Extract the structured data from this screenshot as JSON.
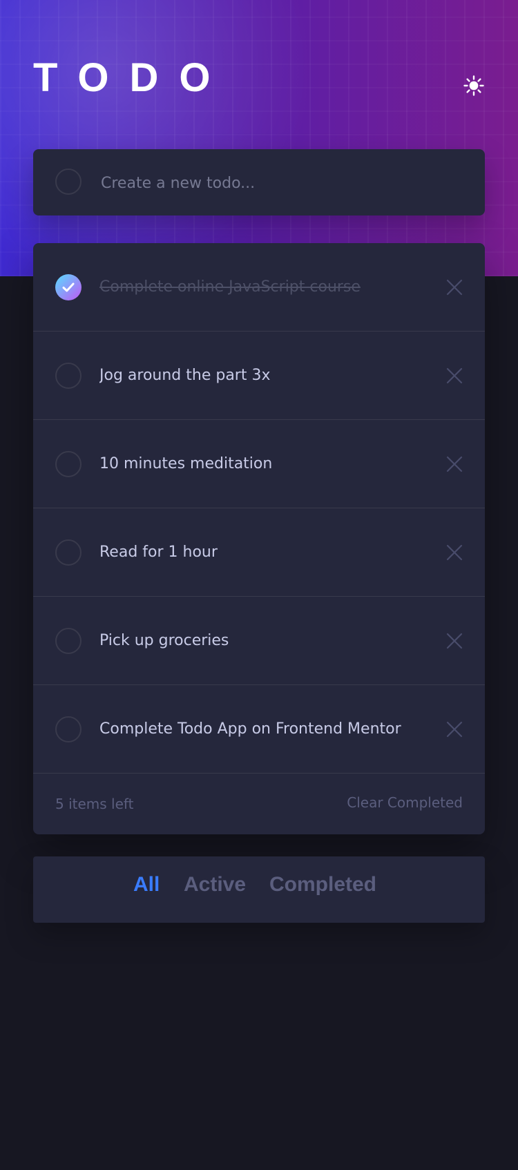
{
  "app": {
    "title": "TODO",
    "theme_icon": "sun-icon"
  },
  "new_todo": {
    "placeholder": "Create a new todo..."
  },
  "todos": [
    {
      "label": "Complete online JavaScript course",
      "completed": true
    },
    {
      "label": "Jog around the part 3x",
      "completed": false
    },
    {
      "label": "10 minutes meditation",
      "completed": false
    },
    {
      "label": "Read for 1 hour",
      "completed": false
    },
    {
      "label": "Pick up groceries",
      "completed": false
    },
    {
      "label": "Complete Todo App on Frontend Mentor",
      "completed": false
    }
  ],
  "footer": {
    "items_left": "5 items left",
    "clear_completed": "Clear Completed"
  },
  "filters": {
    "all": "All",
    "active": "Active",
    "completed": "Completed",
    "selected": "all"
  },
  "colors": {
    "background": "#171722",
    "card": "#25273c",
    "divider": "#393a4c",
    "text": "#c8cbe7",
    "muted": "#5b5e7e",
    "completed_text": "#4d5067",
    "accent": "#3a7cfd",
    "check_gradient_start": "#57ddff",
    "check_gradient_end": "#c058f3"
  },
  "icons": {
    "check": "check-icon",
    "remove": "close-icon",
    "circle": "circle-icon"
  }
}
